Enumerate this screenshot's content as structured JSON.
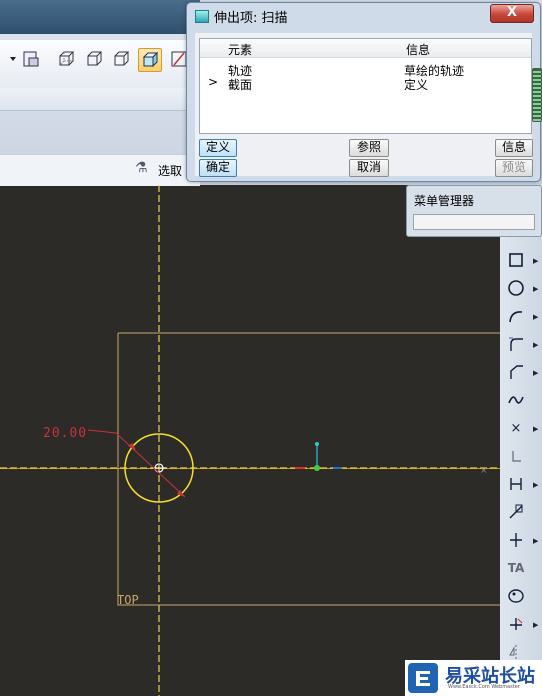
{
  "dialog": {
    "title": "伸出项: 扫描",
    "close_label": "X",
    "columns": [
      "元素",
      "信息"
    ],
    "rows": [
      {
        "marker": "",
        "element": "轨迹",
        "info": "草绘的轨迹"
      },
      {
        "marker": ">",
        "element": "截面",
        "info": "定义"
      }
    ],
    "buttons": {
      "define": "定义",
      "reference": "参照",
      "info": "信息",
      "ok": "确定",
      "cancel": "取消",
      "preview": "预览"
    }
  },
  "menu_manager": {
    "title": "菜单管理器"
  },
  "selection_bar": {
    "label": "选取"
  },
  "canvas": {
    "dimension_value": "20.00",
    "sketch_plane_label": "TOP",
    "colors": {
      "background": "#2d2b28",
      "axis": "#e7d44a",
      "circle": "#f5e12a",
      "dimension": "#c8323c",
      "datum": "#c9a56a",
      "ref_vertical": "#33c4d6",
      "ref_green": "#3fd13f"
    }
  },
  "right_toolbar": {
    "icons": [
      "select-arrow-icon",
      "line-icon",
      "rectangle-icon",
      "circle-icon",
      "arc-icon",
      "fillet-icon",
      "chamfer-icon",
      "spline-icon",
      "point-icon",
      "coordinate-system-icon",
      "dimension-icon",
      "modify-icon",
      "constraint-icon",
      "text-icon",
      "palette-icon",
      "trim-icon",
      "mirror-icon"
    ]
  },
  "watermark": {
    "title": "易采站长站",
    "subtitle": "Www.Easck.Com Webmaster"
  }
}
